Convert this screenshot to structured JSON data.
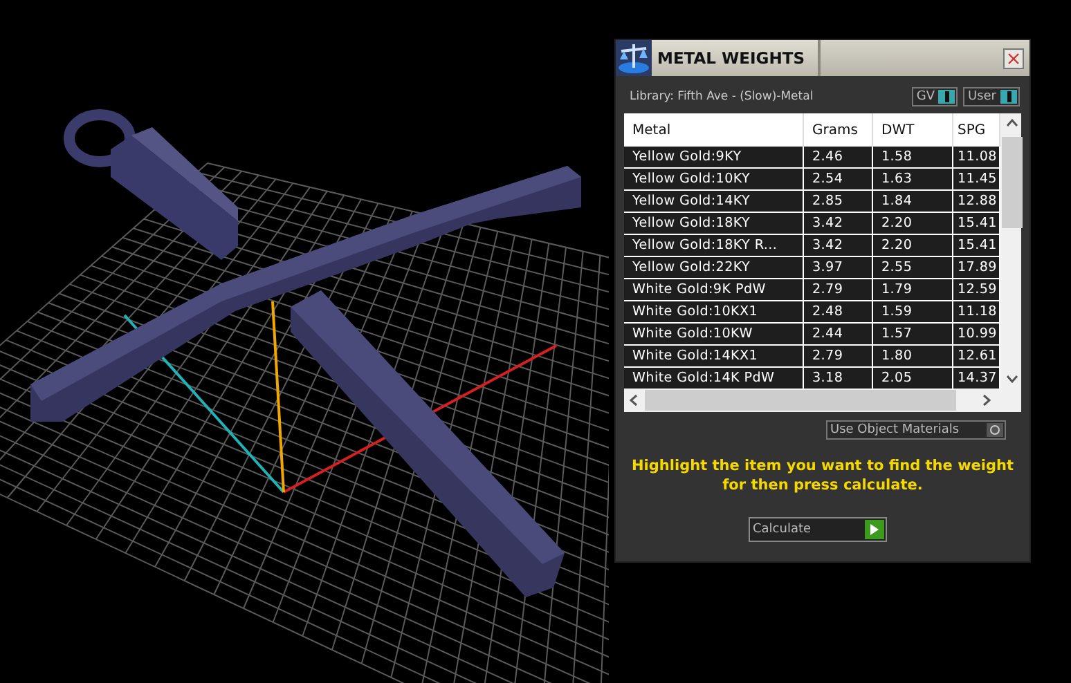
{
  "window": {
    "title": "METAL WEIGHTS"
  },
  "library": {
    "label": "Library: Fifth Ave - (Slow)-Metal"
  },
  "toggles": [
    {
      "label": "GV",
      "on": true
    },
    {
      "label": "User",
      "on": true
    }
  ],
  "table": {
    "columns": [
      "Metal",
      "Grams",
      "DWT",
      "SPG"
    ],
    "rows": [
      [
        "Yellow Gold:9KY",
        "2.46",
        "1.58",
        "11.08"
      ],
      [
        "Yellow Gold:10KY",
        "2.54",
        "1.63",
        "11.45"
      ],
      [
        "Yellow Gold:14KY",
        "2.85",
        "1.84",
        "12.88"
      ],
      [
        "Yellow Gold:18KY",
        "3.42",
        "2.20",
        "15.41"
      ],
      [
        "Yellow Gold:18KY R...",
        "3.42",
        "2.20",
        "15.41"
      ],
      [
        "Yellow Gold:22KY",
        "3.97",
        "2.55",
        "17.89"
      ],
      [
        "White Gold:9K PdW",
        "2.79",
        "1.79",
        "12.59"
      ],
      [
        "White Gold:10KX1",
        "2.48",
        "1.59",
        "11.18"
      ],
      [
        "White Gold:10KW",
        "2.44",
        "1.57",
        "10.99"
      ],
      [
        "White Gold:14KX1",
        "2.79",
        "1.80",
        "12.61"
      ],
      [
        "White Gold:14K PdW",
        "3.18",
        "2.05",
        "14.37"
      ]
    ]
  },
  "option": {
    "label": "Use Object Materials",
    "on": false
  },
  "instruction": "Highlight the item you want to find the weight for then press calculate.",
  "calculate_button": {
    "label": "Calculate"
  }
}
